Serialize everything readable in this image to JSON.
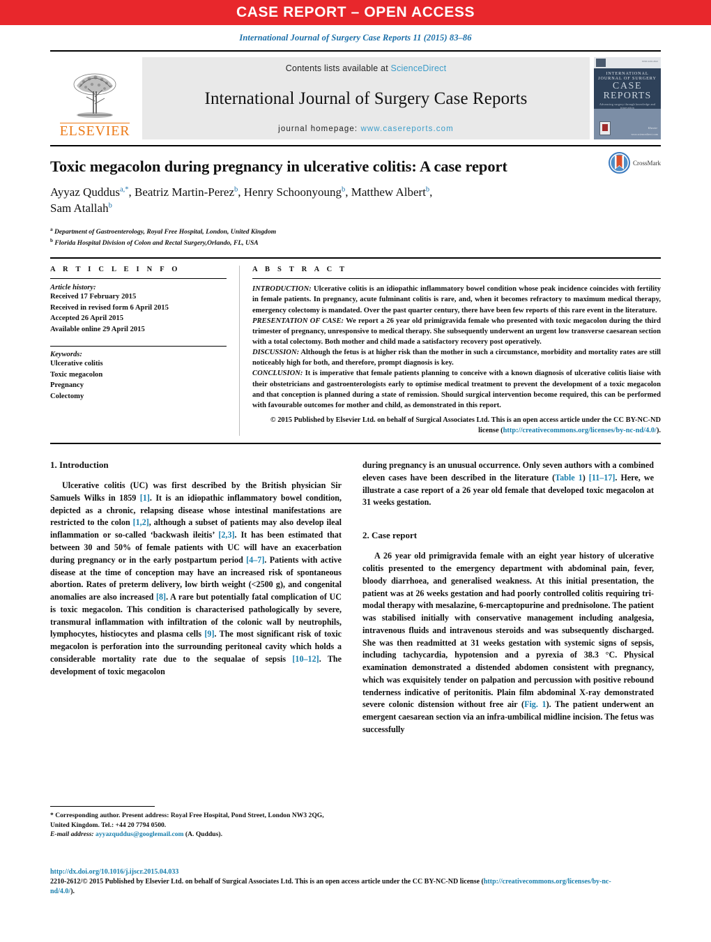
{
  "banner": {
    "text": "CASE REPORT – OPEN ACCESS",
    "bg_color": "#e8272c",
    "text_color": "#ffffff"
  },
  "journal_reference": "International Journal of Surgery Case Reports 11 (2015) 83–86",
  "masthead": {
    "publisher_name": "ELSEVIER",
    "publisher_color": "#ec7a18",
    "contents_prefix": "Contents lists available at ",
    "contents_link": "ScienceDirect",
    "journal_title": "International Journal of Surgery Case Reports",
    "homepage_prefix": "journal homepage: ",
    "homepage_url": "www.casereports.com",
    "link_color": "#3a9cc9",
    "cover": {
      "line1": "INTERNATIONAL",
      "line2": "JOURNAL OF SURGERY",
      "line3": "CASE",
      "line4": "REPORTS",
      "line5": "Advancing surgery through knowledge and innovation",
      "right_text": "Elsevier",
      "right_url": "www.sciencedirect.com",
      "top_right": "ISSN 2210-2612"
    }
  },
  "article": {
    "title": "Toxic megacolon during pregnancy in ulcerative colitis: A case report",
    "crossmark_label": "CrossMark",
    "authors": [
      {
        "name": "Ayyaz Quddus",
        "marks": "a,*"
      },
      {
        "name": "Beatriz Martin-Perez",
        "marks": "b"
      },
      {
        "name": "Henry Schoonyoung",
        "marks": "b"
      },
      {
        "name": "Matthew Albert",
        "marks": "b"
      },
      {
        "name": "Sam Atallah",
        "marks": "b"
      }
    ],
    "affiliations": [
      {
        "mark": "a",
        "text": "Department of Gastroenterology, Royal Free Hospital, London, United Kingdom"
      },
      {
        "mark": "b",
        "text": "Florida Hospital Division of Colon and Rectal Surgery,Orlando, FL, USA"
      }
    ]
  },
  "article_info": {
    "heading": "A R T I C L E   I N F O",
    "history_label": "Article history:",
    "history": [
      "Received 17 February 2015",
      "Received in revised form 6 April 2015",
      "Accepted 26 April 2015",
      "Available online 29 April 2015"
    ],
    "keywords_label": "Keywords:",
    "keywords": [
      "Ulcerative colitis",
      "Toxic megacolon",
      "Pregnancy",
      "Colectomy"
    ]
  },
  "abstract": {
    "heading": "A B S T R A C T",
    "sections": [
      {
        "label": "INTRODUCTION:",
        "text": " Ulcerative colitis is an idiopathic inflammatory bowel condition whose peak incidence coincides with fertility in female patients. In pregnancy, acute fulminant colitis is rare, and, when it becomes refractory to maximum medical therapy, emergency colectomy is mandated. Over the past quarter century, there have been few reports of this rare event in the literature."
      },
      {
        "label": "PRESENTATION OF CASE:",
        "text": " We report a 26 year old primigravida female who presented with toxic megacolon during the third trimester of pregnancy, unresponsive to medical therapy. She subsequently underwent an urgent low transverse caesarean section with a total colectomy. Both mother and child made a satisfactory recovery post operatively."
      },
      {
        "label": "DISCUSSION:",
        "text": " Although the fetus is at higher risk than the mother in such a circumstance, morbidity and mortality rates are still noticeably high for both, and therefore, prompt diagnosis is key."
      },
      {
        "label": "CONCLUSION:",
        "text": " It is imperative that female patients planning to conceive with a known diagnosis of ulcerative colitis liaise with their obstetricians and gastroenterologists early to optimise medical treatment to prevent the development of a toxic megacolon and that conception is planned during a state of remission. Should surgical intervention become required, this can be performed with favourable outcomes for mother and child, as demonstrated in this report."
      }
    ],
    "copyright_pre": "© 2015 Published by Elsevier Ltd. on behalf of Surgical Associates Ltd. This is an open access article under the CC BY-NC-ND license (",
    "copyright_link": "http://creativecommons.org/licenses/by-nc-nd/4.0/",
    "copyright_post": ")."
  },
  "body": {
    "left_column": {
      "section_heading": "1.  Introduction",
      "paragraph_parts": [
        "Ulcerative colitis (UC) was first described by the British physician Sir Samuels Wilks in 1859 ",
        "[1]",
        ". It is an idiopathic inflammatory bowel condition, depicted as a chronic, relapsing disease whose intestinal manifestations are restricted to the colon ",
        "[1,2]",
        ", although a subset of patients may also develop ileal inflammation or so-called ‘backwash ileitis’ ",
        "[2,3]",
        ". It has been estimated that between 30 and 50% of female patients with UC will have an exacerbation during pregnancy or in the early postpartum period ",
        "[4–7]",
        ". Patients with active disease at the time of conception may have an increased risk of spontaneous abortion. Rates of preterm delivery, low birth weight (<2500 g), and congenital anomalies are also increased ",
        "[8]",
        ". A rare but potentially fatal complication of UC is toxic megacolon. This condition is characterised pathologically by severe, transmural inflammation with infiltration of the colonic wall by neutrophils, lymphocytes, histiocytes and plasma cells ",
        "[9]",
        ". The most significant risk of toxic megacolon is perforation into the surrounding peritoneal cavity which holds a considerable mortality rate due to the sequalae of sepsis ",
        "[10–12]",
        ". The development of toxic megacolon"
      ]
    },
    "right_column": {
      "continuation_parts": [
        "during pregnancy is an unusual occurrence. Only seven authors with a combined eleven cases have been described in the literature (",
        "Table 1",
        ") ",
        "[11–17]",
        ". Here, we illustrate a case report of a 26 year old female that developed toxic megacolon at 31 weeks gestation."
      ],
      "section_heading": "2.  Case report",
      "paragraph_parts": [
        "A 26 year old primigravida female with an eight year history of ulcerative colitis presented to the emergency department with abdominal pain, fever, bloody diarrhoea, and generalised weakness. At this initial presentation, the patient was at 26 weeks gestation and had poorly controlled colitis requiring tri-modal therapy with mesalazine, 6-mercaptopurine and prednisolone. The patient was stabilised initially with conservative management including analgesia, intravenous fluids and intravenous steroids and was subsequently discharged. She was then readmitted at 31 weeks gestation with systemic signs of sepsis, including tachycardia, hypotension and a pyrexia of 38.3 °C. Physical examination demonstrated a distended abdomen consistent with pregnancy, which was exquisitely tender on palpation and percussion with positive rebound tenderness indicative of peritonitis. Plain film abdominal X-ray demonstrated severe colonic distension without free air (",
        "Fig. 1",
        "). The patient underwent an emergent caesarean section via an infra-umbilical midline incision. The fetus was successfully"
      ]
    }
  },
  "footnotes": {
    "corresponding": "* Corresponding author. Present address: Royal Free Hospital, Pond Street, London NW3 2QG, United Kingdom. Tel.: +44 20 7794 0500.",
    "email_label": "E-mail address:",
    "email": "ayyazquddus@googlemail.com",
    "email_suffix": "(A. Quddus)."
  },
  "publication_footer": {
    "doi": "http://dx.doi.org/10.1016/j.ijscr.2015.04.033",
    "issn_line_pre": "2210-2612/© 2015 Published by Elsevier Ltd. on behalf of Surgical Associates Ltd. This is an open access article under the CC BY-NC-ND license (",
    "license_url": "http://creativecommons.org/licenses/by-nc-nd/4.0/",
    "issn_line_post": ")."
  }
}
